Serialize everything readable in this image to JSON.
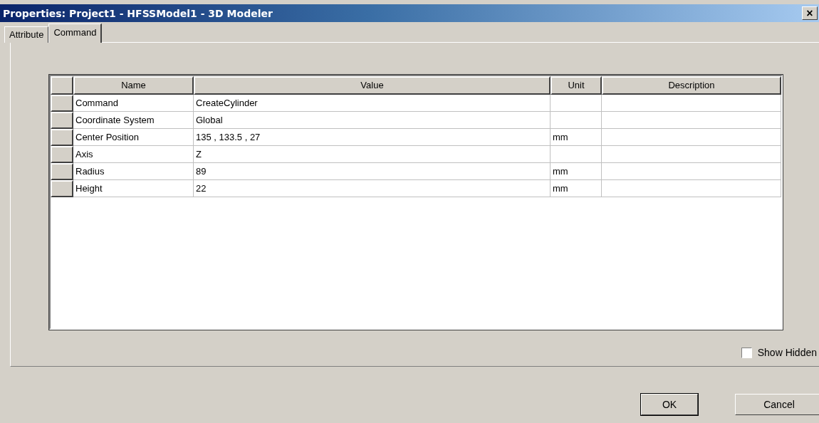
{
  "window": {
    "title": "Properties: Project1 - HFSSModel1 - 3D Modeler",
    "close": "×"
  },
  "tabs": [
    {
      "label": "Attribute",
      "selected": false
    },
    {
      "label": "Command",
      "selected": true
    }
  ],
  "table": {
    "columns": [
      "Name",
      "Value",
      "Unit",
      "Description"
    ],
    "rows": [
      [
        "Command",
        "CreateCylinder",
        "",
        ""
      ],
      [
        "Coordinate System",
        "Global",
        "",
        ""
      ],
      [
        "Center Position",
        "135 , 133.5 , 27",
        "mm",
        ""
      ],
      [
        "Axis",
        "Z",
        "",
        ""
      ],
      [
        "Radius",
        "89",
        "mm",
        ""
      ],
      [
        "Height",
        "22",
        "mm",
        ""
      ]
    ]
  },
  "show_hidden": {
    "label": "Show Hidden",
    "checked": false
  },
  "buttons": [
    {
      "label": "OK",
      "default": true
    },
    {
      "label": "Cancel",
      "default": false
    }
  ]
}
